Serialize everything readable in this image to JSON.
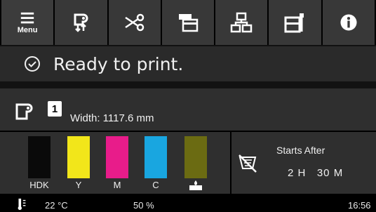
{
  "toolbar": {
    "menu_label": "Menu",
    "buttons": [
      {
        "icon": "menu-icon"
      },
      {
        "icon": "media-feed-icon"
      },
      {
        "icon": "cutter-icon"
      },
      {
        "icon": "job-queue-icon"
      },
      {
        "icon": "network-icon"
      },
      {
        "icon": "maintenance-icon"
      },
      {
        "icon": "info-icon"
      }
    ]
  },
  "status": {
    "icon": "check-circle-icon",
    "text": "Ready to print."
  },
  "media": {
    "icon": "roll-paper-icon",
    "roll_number": "1",
    "width_text": "Width: 1117.6 mm"
  },
  "inks": [
    {
      "label": "HDK",
      "color": "#0a0a0a",
      "level": 1.0
    },
    {
      "label": "Y",
      "color": "#f2e61a",
      "level": 1.0
    },
    {
      "label": "M",
      "color": "#e81c8a",
      "level": 1.0
    },
    {
      "label": "C",
      "color": "#19a6e0",
      "level": 1.0
    },
    {
      "label": "",
      "color": "#6b6b12",
      "level": 1.0,
      "icon": "maintenance-box-icon"
    }
  ],
  "timer": {
    "icon": "drying-timer-icon",
    "label": "Starts After",
    "value": "2 H   30 M"
  },
  "footer": {
    "icon": "thermometer-icon",
    "temperature": "22 °C",
    "humidity": "50 %",
    "time": "16:56"
  }
}
